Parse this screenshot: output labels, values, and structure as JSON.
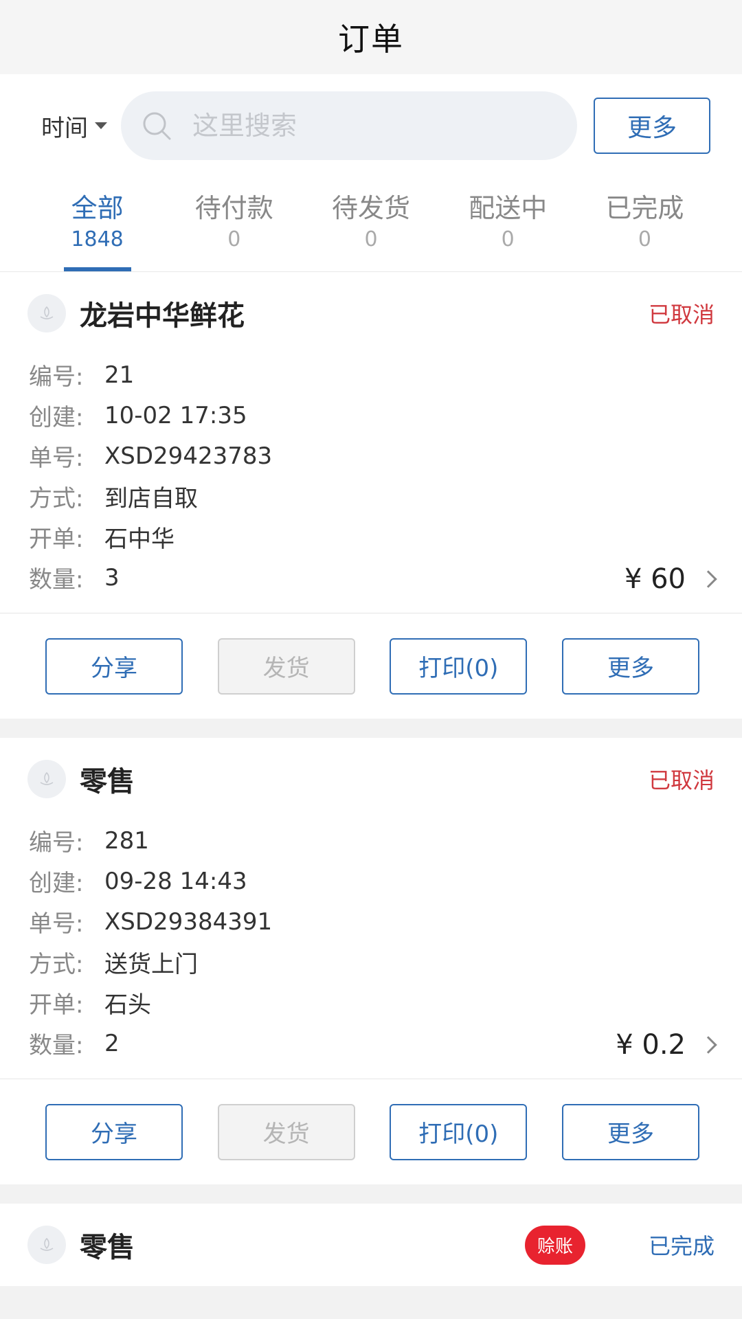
{
  "header": {
    "title": "订单"
  },
  "search": {
    "time_filter": "时间",
    "placeholder": "这里搜索",
    "more": "更多"
  },
  "tabs": [
    {
      "label": "全部",
      "count": "1848",
      "active": true
    },
    {
      "label": "待付款",
      "count": "0"
    },
    {
      "label": "待发货",
      "count": "0"
    },
    {
      "label": "配送中",
      "count": "0"
    },
    {
      "label": "已完成",
      "count": "0"
    }
  ],
  "orders": [
    {
      "shop": "龙岩中华鲜花",
      "status": "已取消",
      "fields": [
        {
          "k": "编号:",
          "v": "21"
        },
        {
          "k": "创建:",
          "v": "10-02 17:35"
        },
        {
          "k": "单号:",
          "v": "XSD29423783"
        },
        {
          "k": "方式:",
          "v": "到店自取"
        },
        {
          "k": "开单:",
          "v": "石中华"
        },
        {
          "k": "数量:",
          "v": "3"
        }
      ],
      "price": "¥ 60",
      "actions": {
        "share": "分享",
        "ship": "发货",
        "print": "打印(0)",
        "more": "更多"
      }
    },
    {
      "shop": "零售",
      "status": "已取消",
      "fields": [
        {
          "k": "编号:",
          "v": "281"
        },
        {
          "k": "创建:",
          "v": "09-28 14:43"
        },
        {
          "k": "单号:",
          "v": "XSD29384391"
        },
        {
          "k": "方式:",
          "v": "送货上门"
        },
        {
          "k": "开单:",
          "v": "石头"
        },
        {
          "k": "数量:",
          "v": "2"
        }
      ],
      "price": "¥ 0.2",
      "actions": {
        "share": "分享",
        "ship": "发货",
        "print": "打印(0)",
        "more": "更多"
      }
    },
    {
      "shop": "零售",
      "badge": "赊账",
      "status": "已完成"
    }
  ],
  "colors": {
    "accent": "#2f6db5",
    "cancelled": "#d0383e",
    "badge": "#e8232f"
  }
}
